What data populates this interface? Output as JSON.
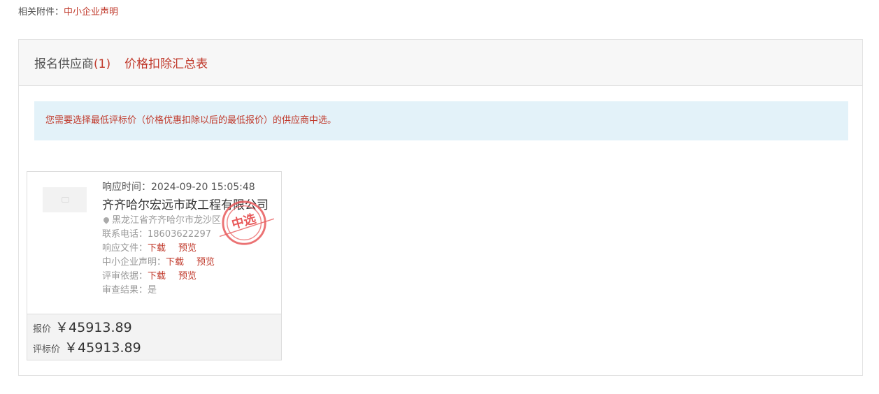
{
  "attachment": {
    "label": "相关附件：",
    "link": "中小企业声明"
  },
  "tabs": {
    "suppliers_label": "报名供应商",
    "suppliers_count": "(1)",
    "deduction": "价格扣除汇总表"
  },
  "notice": "您需要选择最低评标价（价格优惠扣除以后的最低报价）的供应商中选。",
  "supplier": {
    "response_time_label": "响应时间：",
    "response_time": "2024-09-20 15:05:48",
    "name": "齐齐哈尔宏远市政工程有限公司",
    "address": "黑龙江省齐齐哈尔市龙沙区",
    "phone_label": "联系电话：",
    "phone": "18603622297",
    "response_file_label": "响应文件：",
    "sme_label": "中小企业声明：",
    "basis_label": "评审依据：",
    "download": "下载",
    "preview": "预览",
    "review_label": "审查结果：",
    "review_result": "是",
    "stamp": "中选",
    "price_label": "报价",
    "price": "￥45913.89",
    "eval_price_label": "评标价",
    "eval_price": "￥45913.89"
  },
  "colors": {
    "accent": "#c0392b",
    "notice_bg": "#e3f2f9",
    "stamp": "#e8595a"
  }
}
